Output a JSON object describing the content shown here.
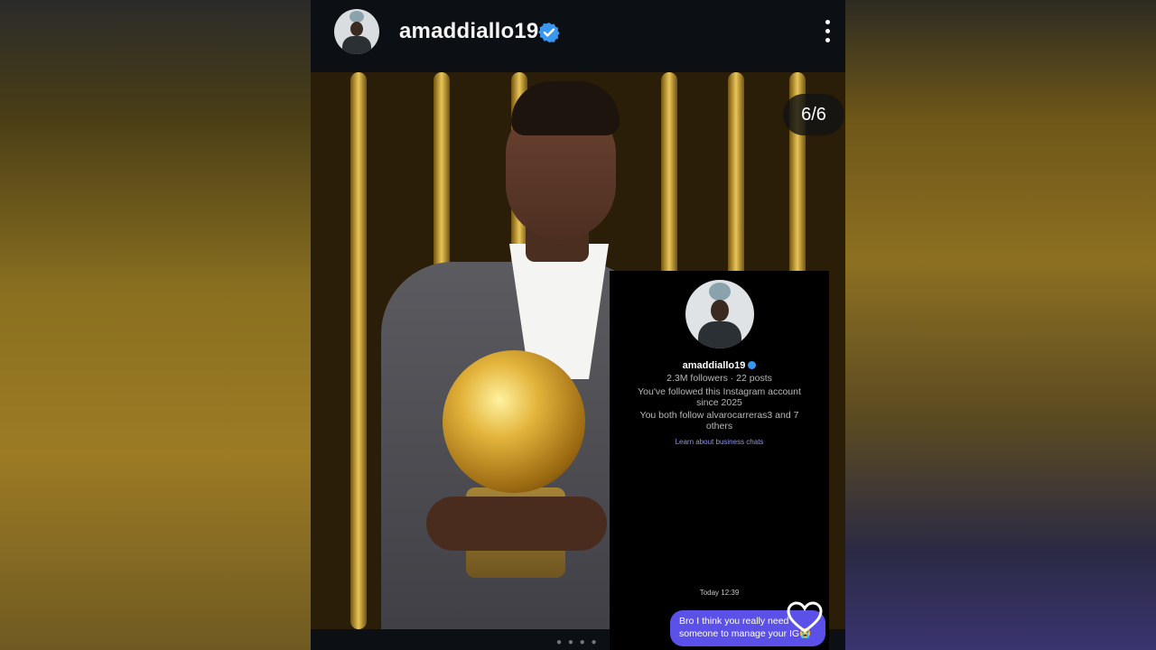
{
  "post": {
    "username": "amaddiallo19",
    "verified": true,
    "slide_counter": "6/6"
  },
  "dm_screenshot": {
    "username": "amaddiallo19",
    "stats": "2.3M followers · 22 posts",
    "followed_line_1": "You've followed this Instagram account",
    "followed_line_2": "since 2025",
    "mutual_line_1": "You both follow alvarocarreras3 and 7",
    "mutual_line_2": "others",
    "link": "Learn about business chats",
    "timestamp": "Today 12:39",
    "message_line_1": "Bro I think you really need",
    "message_line_2": "someone to manage your IG😭"
  },
  "colors": {
    "accent_verified": "#3897f0",
    "message_bubble": "#5b51e8",
    "link": "#8e97e8"
  },
  "icons": [
    "verified-badge-icon",
    "more-options-icon",
    "heart-reaction-icon"
  ]
}
